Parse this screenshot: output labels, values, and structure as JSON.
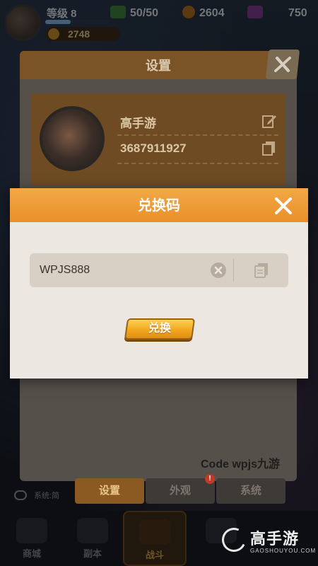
{
  "hud": {
    "level_label": "等级 8",
    "gold": "2748",
    "stamina": "50/50",
    "coins": "2604",
    "gems": "750"
  },
  "settings": {
    "title": "设置",
    "profile": {
      "name": "高手游",
      "id": "3687911927"
    },
    "footer_text": "Code wpjs九游",
    "tabs": [
      {
        "label": "设置"
      },
      {
        "label": "外观"
      },
      {
        "label": "系统"
      }
    ]
  },
  "chat": {
    "text": "系统:简"
  },
  "bottom_nav": [
    {
      "label": "商城"
    },
    {
      "label": "副本"
    },
    {
      "label": "战斗"
    },
    {
      "label": ""
    },
    {
      "label": ""
    }
  ],
  "redeem_dialog": {
    "title": "兑换码",
    "code_value": "WPJS888",
    "button_label": "兑换"
  },
  "watermark": {
    "name": "高手游",
    "domain": "GAOSHOUYOU.COM"
  },
  "colors": {
    "dialog_header": "#f0a23c",
    "dialog_body": "#ece7e1",
    "button": "#f2a81e"
  }
}
